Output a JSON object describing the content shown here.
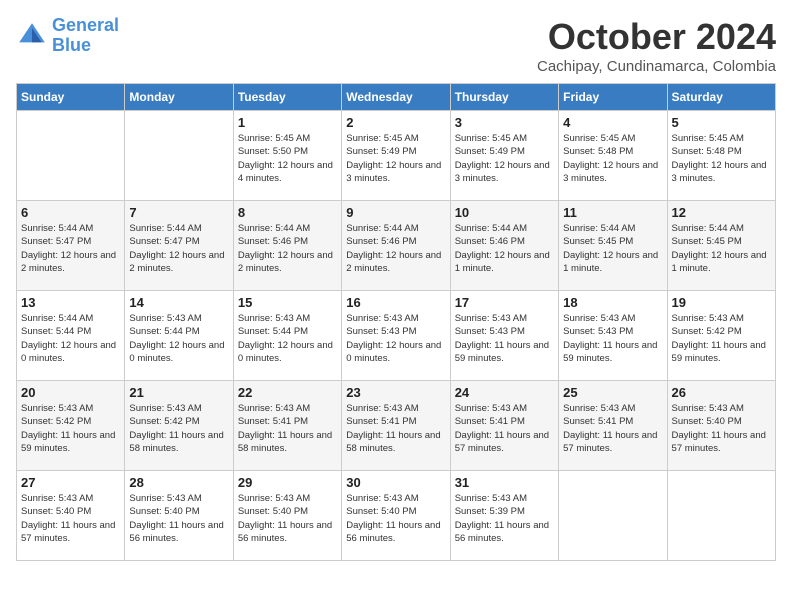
{
  "header": {
    "logo_line1": "General",
    "logo_line2": "Blue",
    "month": "October 2024",
    "location": "Cachipay, Cundinamarca, Colombia"
  },
  "weekdays": [
    "Sunday",
    "Monday",
    "Tuesday",
    "Wednesday",
    "Thursday",
    "Friday",
    "Saturday"
  ],
  "weeks": [
    [
      {
        "day": "",
        "empty": true
      },
      {
        "day": "",
        "empty": true
      },
      {
        "day": "1",
        "sunrise": "5:45 AM",
        "sunset": "5:50 PM",
        "daylight": "12 hours and 4 minutes."
      },
      {
        "day": "2",
        "sunrise": "5:45 AM",
        "sunset": "5:49 PM",
        "daylight": "12 hours and 3 minutes."
      },
      {
        "day": "3",
        "sunrise": "5:45 AM",
        "sunset": "5:49 PM",
        "daylight": "12 hours and 3 minutes."
      },
      {
        "day": "4",
        "sunrise": "5:45 AM",
        "sunset": "5:48 PM",
        "daylight": "12 hours and 3 minutes."
      },
      {
        "day": "5",
        "sunrise": "5:45 AM",
        "sunset": "5:48 PM",
        "daylight": "12 hours and 3 minutes."
      }
    ],
    [
      {
        "day": "6",
        "sunrise": "5:44 AM",
        "sunset": "5:47 PM",
        "daylight": "12 hours and 2 minutes."
      },
      {
        "day": "7",
        "sunrise": "5:44 AM",
        "sunset": "5:47 PM",
        "daylight": "12 hours and 2 minutes."
      },
      {
        "day": "8",
        "sunrise": "5:44 AM",
        "sunset": "5:46 PM",
        "daylight": "12 hours and 2 minutes."
      },
      {
        "day": "9",
        "sunrise": "5:44 AM",
        "sunset": "5:46 PM",
        "daylight": "12 hours and 2 minutes."
      },
      {
        "day": "10",
        "sunrise": "5:44 AM",
        "sunset": "5:46 PM",
        "daylight": "12 hours and 1 minute."
      },
      {
        "day": "11",
        "sunrise": "5:44 AM",
        "sunset": "5:45 PM",
        "daylight": "12 hours and 1 minute."
      },
      {
        "day": "12",
        "sunrise": "5:44 AM",
        "sunset": "5:45 PM",
        "daylight": "12 hours and 1 minute."
      }
    ],
    [
      {
        "day": "13",
        "sunrise": "5:44 AM",
        "sunset": "5:44 PM",
        "daylight": "12 hours and 0 minutes."
      },
      {
        "day": "14",
        "sunrise": "5:43 AM",
        "sunset": "5:44 PM",
        "daylight": "12 hours and 0 minutes."
      },
      {
        "day": "15",
        "sunrise": "5:43 AM",
        "sunset": "5:44 PM",
        "daylight": "12 hours and 0 minutes."
      },
      {
        "day": "16",
        "sunrise": "5:43 AM",
        "sunset": "5:43 PM",
        "daylight": "12 hours and 0 minutes."
      },
      {
        "day": "17",
        "sunrise": "5:43 AM",
        "sunset": "5:43 PM",
        "daylight": "11 hours and 59 minutes."
      },
      {
        "day": "18",
        "sunrise": "5:43 AM",
        "sunset": "5:43 PM",
        "daylight": "11 hours and 59 minutes."
      },
      {
        "day": "19",
        "sunrise": "5:43 AM",
        "sunset": "5:42 PM",
        "daylight": "11 hours and 59 minutes."
      }
    ],
    [
      {
        "day": "20",
        "sunrise": "5:43 AM",
        "sunset": "5:42 PM",
        "daylight": "11 hours and 59 minutes."
      },
      {
        "day": "21",
        "sunrise": "5:43 AM",
        "sunset": "5:42 PM",
        "daylight": "11 hours and 58 minutes."
      },
      {
        "day": "22",
        "sunrise": "5:43 AM",
        "sunset": "5:41 PM",
        "daylight": "11 hours and 58 minutes."
      },
      {
        "day": "23",
        "sunrise": "5:43 AM",
        "sunset": "5:41 PM",
        "daylight": "11 hours and 58 minutes."
      },
      {
        "day": "24",
        "sunrise": "5:43 AM",
        "sunset": "5:41 PM",
        "daylight": "11 hours and 57 minutes."
      },
      {
        "day": "25",
        "sunrise": "5:43 AM",
        "sunset": "5:41 PM",
        "daylight": "11 hours and 57 minutes."
      },
      {
        "day": "26",
        "sunrise": "5:43 AM",
        "sunset": "5:40 PM",
        "daylight": "11 hours and 57 minutes."
      }
    ],
    [
      {
        "day": "27",
        "sunrise": "5:43 AM",
        "sunset": "5:40 PM",
        "daylight": "11 hours and 57 minutes."
      },
      {
        "day": "28",
        "sunrise": "5:43 AM",
        "sunset": "5:40 PM",
        "daylight": "11 hours and 56 minutes."
      },
      {
        "day": "29",
        "sunrise": "5:43 AM",
        "sunset": "5:40 PM",
        "daylight": "11 hours and 56 minutes."
      },
      {
        "day": "30",
        "sunrise": "5:43 AM",
        "sunset": "5:40 PM",
        "daylight": "11 hours and 56 minutes."
      },
      {
        "day": "31",
        "sunrise": "5:43 AM",
        "sunset": "5:39 PM",
        "daylight": "11 hours and 56 minutes."
      },
      {
        "day": "",
        "empty": true
      },
      {
        "day": "",
        "empty": true
      }
    ]
  ]
}
